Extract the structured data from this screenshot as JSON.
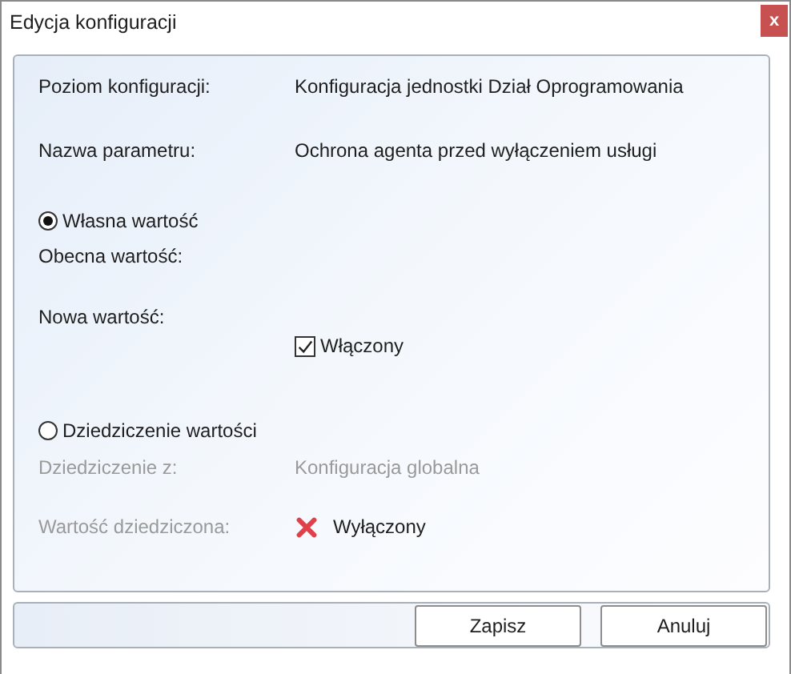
{
  "window": {
    "title": "Edycja konfiguracji",
    "close": "x"
  },
  "info": [
    {
      "label": "Poziom konfiguracji:",
      "value": "Konfiguracja jednostki Dział Oprogramowania"
    },
    {
      "label": "Nazwa parametru:",
      "value": "Ochrona agenta przed wyłączeniem usługi"
    }
  ],
  "own_value": {
    "label": "Własna wartość",
    "selected": true,
    "current_label": "Obecna wartość:",
    "new_label": "Nowa wartość:",
    "checkbox": {
      "label": "Włączony",
      "checked": true
    }
  },
  "inherit": {
    "label": "Dziedziczenie wartości",
    "selected": false,
    "disabled": true,
    "rows": [
      {
        "kind": "text",
        "label": "Dziedziczenie z:",
        "value": "Konfiguracja globalna"
      },
      {
        "kind": "flag",
        "label": "Wartość dziedziczona:",
        "value": "Wyłączony",
        "on": false
      }
    ]
  },
  "buttons": [
    {
      "label": "Zapisz"
    },
    {
      "label": "Anuluj"
    }
  ]
}
